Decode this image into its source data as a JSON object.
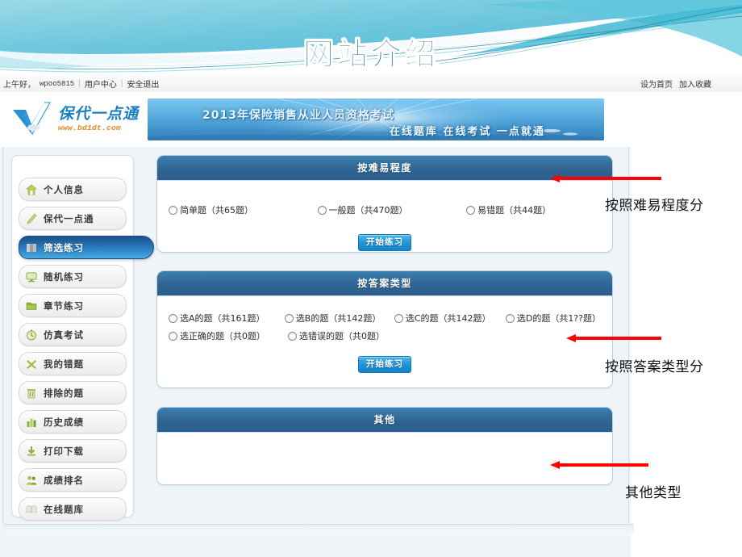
{
  "slide": {
    "title": "网站介绍",
    "accent_color": "#1b6a86",
    "header_gradient_from": "#9fd9e8",
    "header_gradient_to": "#53bcd6"
  },
  "topbar": {
    "greeting": "上午好，",
    "username": "wpoo5815",
    "sep": "|",
    "user_center": "用户中心",
    "logout": "安全退出",
    "set_homepage": "设为首页",
    "add_favorite": "加入收藏"
  },
  "logo": {
    "name": "保代一点通",
    "url": "www.bd1dt.com",
    "mark_icon": "check-mark-icon"
  },
  "banner": {
    "line1": "2013年保险销售从业人员资格考试",
    "line2": "在线题库 在线考试 一点就通"
  },
  "sidebar": {
    "items": [
      {
        "label": "个人信息",
        "icon": "home-icon",
        "active": false
      },
      {
        "label": "保代一点通",
        "icon": "pencil-icon",
        "active": false
      },
      {
        "label": "筛选练习",
        "icon": "filter-icon",
        "active": true
      },
      {
        "label": "随机练习",
        "icon": "monitor-icon",
        "active": false
      },
      {
        "label": "章节练习",
        "icon": "folder-icon",
        "active": false
      },
      {
        "label": "仿真考试",
        "icon": "clock-icon",
        "active": false
      },
      {
        "label": "我的错题",
        "icon": "cross-icon",
        "active": false
      },
      {
        "label": "排除的题",
        "icon": "trash-icon",
        "active": false
      },
      {
        "label": "历史成绩",
        "icon": "bar-chart-icon",
        "active": false
      },
      {
        "label": "打印下载",
        "icon": "download-icon",
        "active": false
      },
      {
        "label": "成绩排名",
        "icon": "users-icon",
        "active": false
      },
      {
        "label": "在线题库",
        "icon": "book-icon",
        "active": false
      }
    ]
  },
  "panels": [
    {
      "title": "按难易程度",
      "options_rows": [
        [
          "简单题（共65题）",
          "一般题（共470题）",
          "易错题（共44题）"
        ]
      ],
      "button": "开始练习"
    },
    {
      "title": "按答案类型",
      "options_rows": [
        [
          "选A的题（共161题）",
          "选B的题（共142题）",
          "选C的题（共142题）",
          "选D的题（共1??题）"
        ],
        [
          "选正确的题（共0题）",
          "选错误的题（共0题）"
        ]
      ],
      "button": "开始练习"
    },
    {
      "title": "其他",
      "options_rows": [],
      "button": ""
    }
  ],
  "annotations": [
    {
      "label": "按照难易程度分",
      "arrow_color": "#ff0000"
    },
    {
      "label": "按照答案类型分",
      "arrow_color": "#ff0000"
    },
    {
      "label": "其他类型",
      "arrow_color": "#ff0000"
    }
  ]
}
